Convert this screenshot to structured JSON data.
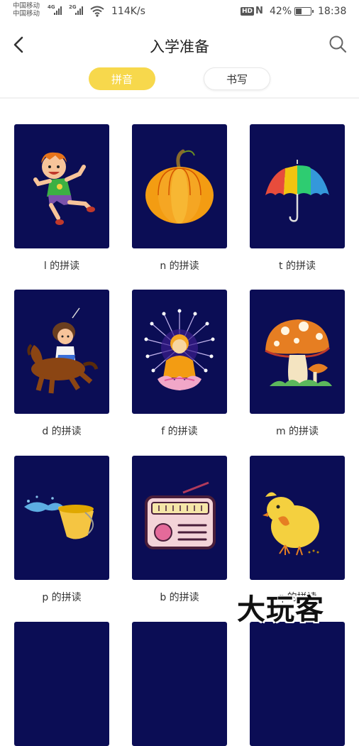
{
  "status_bar": {
    "carrier_1": "中国移动",
    "carrier_2": "中国移动",
    "net_1": "4G",
    "net_2": "2G",
    "speed": "114K/s",
    "hd": "HD",
    "nfc": "N",
    "battery_percent": "42%",
    "battery_level": 0.42,
    "time": "18:38"
  },
  "header": {
    "title": "入学准备"
  },
  "tabs": [
    {
      "label": "拼音",
      "active": true
    },
    {
      "label": "书写",
      "active": false
    }
  ],
  "cards": [
    {
      "label": "l 的拼读",
      "image": "jumping-boy"
    },
    {
      "label": "n 的拼读",
      "image": "pumpkin"
    },
    {
      "label": "t 的拼读",
      "image": "umbrella"
    },
    {
      "label": "d 的拼读",
      "image": "girl-on-horse"
    },
    {
      "label": "f 的拼读",
      "image": "buddha"
    },
    {
      "label": "m 的拼读",
      "image": "mushroom"
    },
    {
      "label": "p 的拼读",
      "image": "water-bucket"
    },
    {
      "label": "b 的拼读",
      "image": "radio"
    },
    {
      "label": "q 的拼读",
      "image": "chick"
    }
  ],
  "watermark": "大玩客",
  "colors": {
    "accent": "#f7d84c",
    "card_bg": "#0b0d55"
  }
}
